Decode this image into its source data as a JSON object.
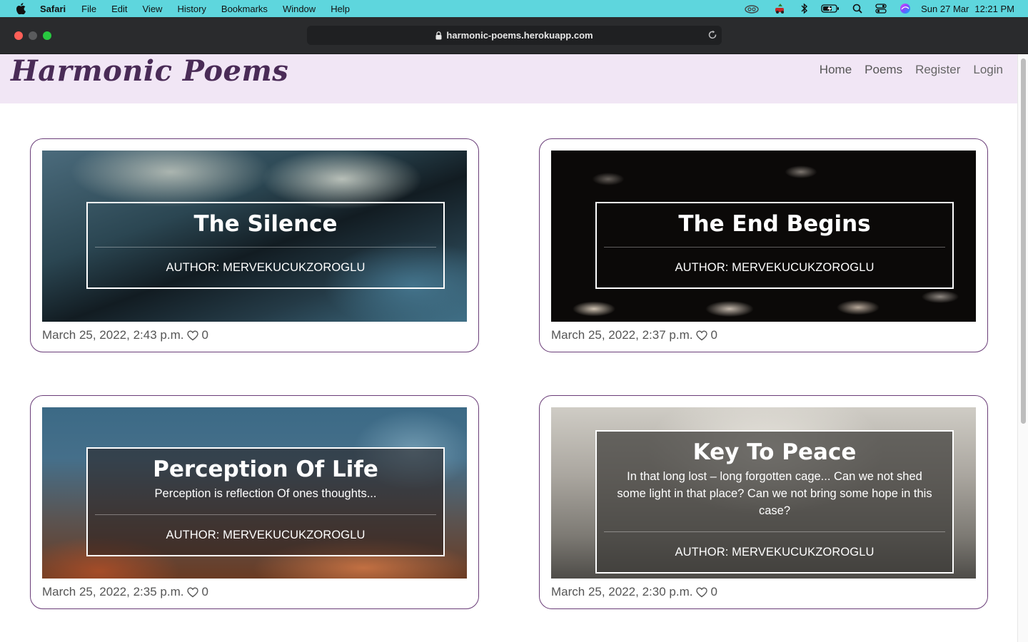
{
  "menubar": {
    "app": "Safari",
    "items": [
      "File",
      "Edit",
      "View",
      "History",
      "Bookmarks",
      "Window",
      "Help"
    ],
    "date": "Sun 27 Mar",
    "time": "12:21 PM"
  },
  "browser": {
    "url": "harmonic-poems.herokuapp.com"
  },
  "site": {
    "brand": "Harmonic Poems",
    "nav": [
      "Home",
      "Poems",
      "Register",
      "Login"
    ]
  },
  "poems": [
    {
      "title": "The Silence",
      "excerpt": "",
      "author": "AUTHOR: MERVEKUCUKZOROGLU",
      "date": "March 25, 2022, 2:43 p.m.",
      "likes": "0"
    },
    {
      "title": "The End Begins",
      "excerpt": "",
      "author": "AUTHOR: MERVEKUCUKZOROGLU",
      "date": "March 25, 2022, 2:37 p.m.",
      "likes": "0"
    },
    {
      "title": "Perception Of Life",
      "excerpt": "Perception is reflection Of ones thoughts...",
      "author": "AUTHOR: MERVEKUCUKZOROGLU",
      "date": "March 25, 2022, 2:35 p.m.",
      "likes": "0"
    },
    {
      "title": "Key To Peace",
      "excerpt": "In that long lost – long forgotten cage... Can we not shed some light in that place? Can we not bring some hope in this case?",
      "author": "AUTHOR: MERVEKUCUKZOROGLU",
      "date": "March 25, 2022, 2:30 p.m.",
      "likes": "0"
    }
  ],
  "colors": {
    "menubar": "#5ed6dd",
    "toolbar": "#2a2b2d",
    "header": "#f1e6f5",
    "brand": "#4a2b57",
    "card_border": "#6a3d78"
  }
}
